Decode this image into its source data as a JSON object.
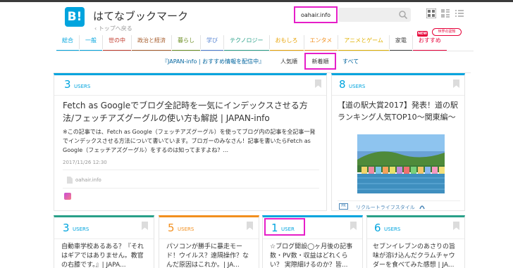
{
  "header": {
    "logo_text": "B!",
    "site_title": "はてなブックマーク",
    "breadcrumb": "‹ トップへ戻る",
    "search_query": "oahair.info",
    "search_placeholder": ""
  },
  "categories": [
    {
      "label": "総合",
      "color": "#00a4de",
      "active": true
    },
    {
      "label": "一般",
      "color": "#00a4de",
      "active": false
    },
    {
      "label": "世の中",
      "color": "#c0392b",
      "active": false
    },
    {
      "label": "政治と経済",
      "color": "#a55b2a",
      "active": false
    },
    {
      "label": "暮らし",
      "color": "#6b8e23",
      "active": false
    },
    {
      "label": "学び",
      "color": "#4a7bd0",
      "active": false
    },
    {
      "label": "テクノロジー",
      "color": "#29a089",
      "active": false
    },
    {
      "label": "おもしろ",
      "color": "#e8a100",
      "active": false
    },
    {
      "label": "エンタメ",
      "color": "#f28f1e",
      "active": false
    },
    {
      "label": "アニメとゲーム",
      "color": "#e0b100",
      "active": false
    },
    {
      "label": "家電",
      "color": "#444444",
      "active": false
    },
    {
      "label": "おすすめ",
      "color": "#e60039",
      "active": false
    }
  ],
  "badges": {
    "new": "NEW",
    "world": "世界の認知"
  },
  "sort": {
    "feed_title": "『JAPAN-info | おすすめ情報を配信中』",
    "popular": "人気順",
    "newest": "新着順",
    "all": "すべて"
  },
  "main_card": {
    "count": "3",
    "users_label": "USERS",
    "title": "Fetch as Googleでブログ全記時を一気にインデックスさせる方法/フェッチアズグーグルの使い方も解説 | JAPAN-info",
    "description": "※この記事では、Fetch as Google（フェッチアズグーグル）を使ってブログ内の記事を全記事一発でインデックスさせる方法について書いています。ブロガーのみなさん！記事を書いたらFetch as Google（フェッチアズグーグル）をするのは知ってますよね？...",
    "date": "2017/11/26 12:30",
    "domain": "oahair.info"
  },
  "side_card": {
    "count": "8",
    "users_label": "USERS",
    "title": "【道の駅大賞2017】発表！道の駅ランキング人気TOP10～関東編～",
    "pr_label": "PR",
    "sponsor": "リクルートライフスタイル"
  },
  "small_cards": [
    {
      "count": "3",
      "users_label": "USERS",
      "title": "自動車学校あるある？『それはギアではありません。教官の右膝です。』| JAPA...",
      "color": "#29a089"
    },
    {
      "count": "5",
      "users_label": "USERS",
      "title": "パソコンが勝手に暴走モード！ウイルス？遠隔操作？なんだ原因はこれか。| JA...",
      "color": "#f28f1e"
    },
    {
      "count": "1",
      "users_label": "USER",
      "title": "☆ブログ開設◯ヶ月後の記事数・PV数・収益はどれくらい？ 実際細けるのか？皆...",
      "color": "#00a4de"
    },
    {
      "count": "6",
      "users_label": "USERS",
      "title": "セブンイレブンのあさりの旨味が溶け込んだクラムチャウダーを食べてみた感想 | JA...",
      "color": "#29a089"
    }
  ],
  "colors": {
    "accent": "#00a4de",
    "highlight": "#e61ec8"
  }
}
